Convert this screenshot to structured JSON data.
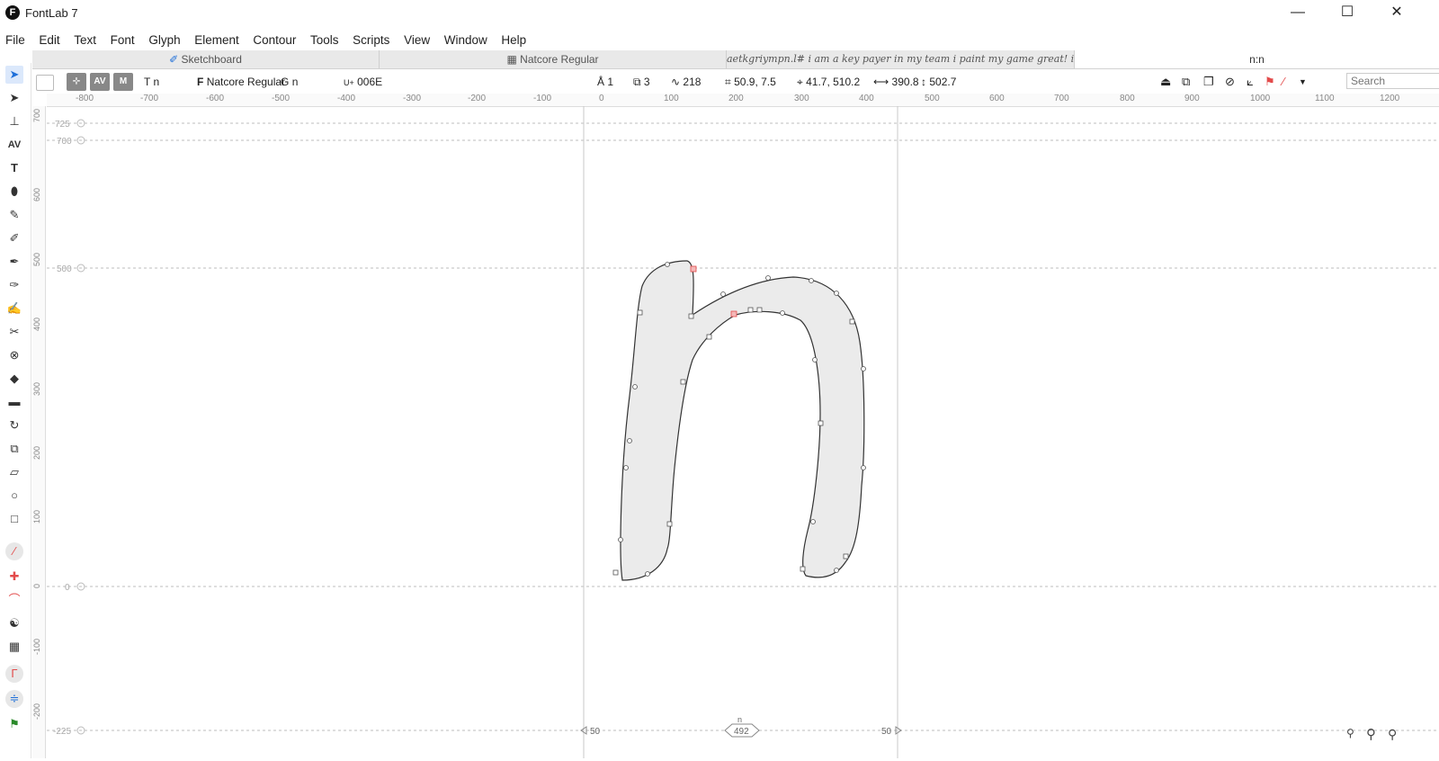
{
  "app": {
    "logo": "F",
    "title": "FontLab 7"
  },
  "window_controls": {
    "minimize": "—",
    "maximize": "☐",
    "close": "✕"
  },
  "menu": [
    "File",
    "Edit",
    "Text",
    "Font",
    "Glyph",
    "Element",
    "Contour",
    "Tools",
    "Scripts",
    "View",
    "Window",
    "Help"
  ],
  "tabs": [
    {
      "label": "Sketchboard",
      "icon": "✐"
    },
    {
      "label": "Natcore Regular",
      "icon": "▦"
    },
    {
      "label": "aetkgriympn.l# i am a key payer in my team i paint my game great! i p",
      "icon": ""
    },
    {
      "label": "n:n",
      "icon": ""
    }
  ],
  "toolbar": {
    "font_prefix": "F",
    "font_name": "Natcore Regular",
    "glyph_prefix": "G",
    "glyph_name": "n",
    "text_prefix": "T",
    "text_value": "n",
    "unicode_prefix": "U+",
    "unicode": "006E",
    "elements": "1",
    "contours": "3",
    "nodes": "218",
    "position": "50.9, 7.5",
    "origin": "41.7, 510.2",
    "width": "390.8",
    "height": "502.7",
    "search_placeholder": "Search"
  },
  "ruler_labels": [
    "-800",
    "-700",
    "-600",
    "-500",
    "-400",
    "-300",
    "-200",
    "-100",
    "0",
    "100",
    "200",
    "300",
    "400",
    "500",
    "600",
    "700",
    "800",
    "900",
    "1000",
    "1100",
    "1200"
  ],
  "vruler_labels": [
    "700",
    "600",
    "500",
    "400",
    "300",
    "200",
    "100",
    "0",
    "-100",
    "-200"
  ],
  "metrics": {
    "ascender": "725",
    "cap": "700",
    "xheight": "500",
    "baseline": "0",
    "descender": "-225"
  },
  "sidebearings": {
    "left": "50",
    "right": "50",
    "advance": "492",
    "glyph_label": "n"
  },
  "colors": {
    "accent": "#1e6fd9",
    "node_selected": "#e34b4b",
    "glyph_fill": "#ebebeb"
  }
}
